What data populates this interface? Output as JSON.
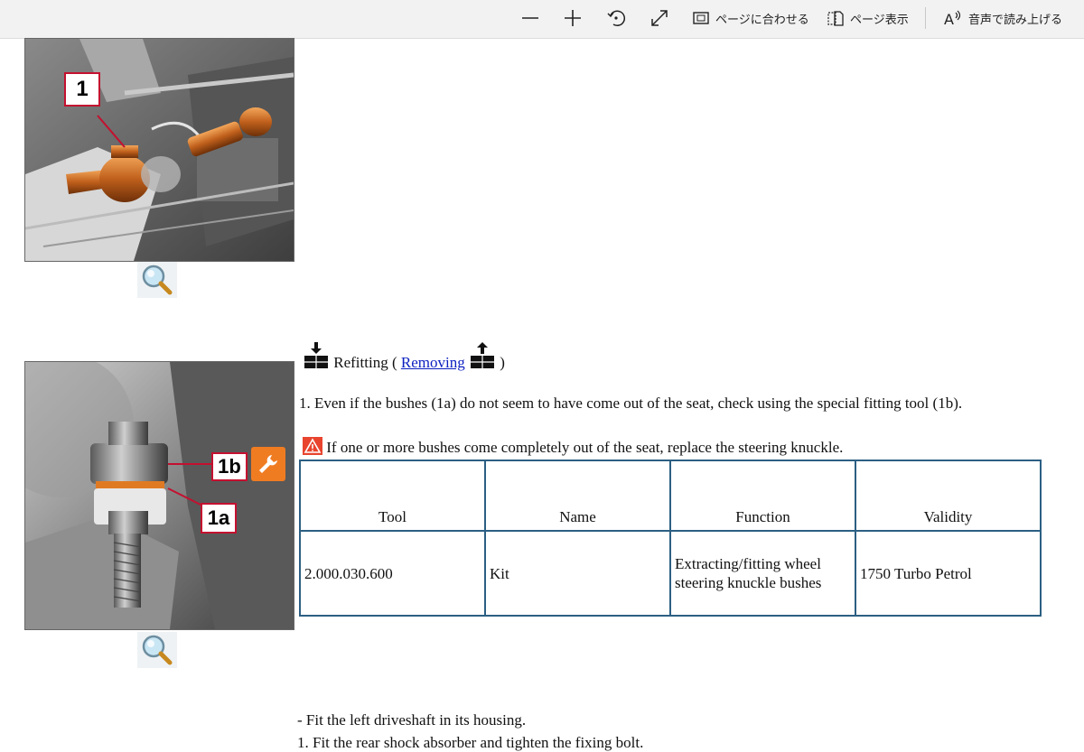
{
  "toolbar": {
    "fit_label": "ページに合わせる",
    "view_label": "ページ表示",
    "read_aloud_label": "音声で読み上げる"
  },
  "figure1": {
    "callout": "1"
  },
  "figure2": {
    "callout_1b": "1b",
    "callout_1a": "1a"
  },
  "refitting": {
    "label": "Refitting (",
    "link": "Removing",
    "close": ")"
  },
  "step1": "1. Even if the bushes (1a) do not seem to have come out of the seat, check using the special fitting tool (1b).",
  "warning": "If one or more bushes come completely out of the seat, replace the steering knuckle.",
  "table": {
    "headers": [
      "Tool",
      "Name",
      "Function",
      "Validity"
    ],
    "row": {
      "tool": "2.000.030.600",
      "name": "Kit",
      "function_line1": "Extracting/fitting wheel",
      "function_line2": "steering knuckle bushes",
      "validity": "1750 Turbo Petrol"
    }
  },
  "fit_driveshaft": "- Fit the left driveshaft in its housing.",
  "cut_line": "1. Fit the rear shock absorber and tighten the fixing bolt."
}
